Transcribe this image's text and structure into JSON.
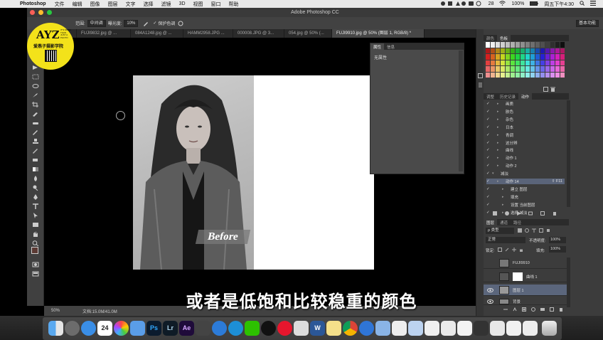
{
  "menubar": {
    "app_name": "Photoshop",
    "items": [
      "文件",
      "编辑",
      "图像",
      "图层",
      "文字",
      "选择",
      "滤镜",
      "3D",
      "视图",
      "窗口",
      "帮助"
    ],
    "battery": "100%",
    "clock": "周五下午4:30",
    "badge_count": "28"
  },
  "window": {
    "title": "Adobe Photoshop CC"
  },
  "options_bar": {
    "range_label": "范围:",
    "range_value": "中间调",
    "exposure_label": "曝光度:",
    "exposure_value": "10%",
    "protect_tones_label": "保护色调",
    "workspace": "基本功能"
  },
  "tabs": [
    {
      "label": ".jpg @ ...",
      "active": false
    },
    {
      "label": "FUJI9832.jpg @ ...",
      "active": false
    },
    {
      "label": "084A1248.jpg @ ...",
      "active": false
    },
    {
      "label": "HAMM2958.JPG ...",
      "active": false
    },
    {
      "label": "000008.JPG @ 3...",
      "active": false
    },
    {
      "label": "054.jpg @ 50% (...",
      "active": false
    },
    {
      "label": "FUJI9910.jpg @ 50% (图层 1, RGB/8) *",
      "active": true
    }
  ],
  "canvas": {
    "before_label": "Before"
  },
  "properties_panel": {
    "tabs": [
      "属性",
      "信息"
    ],
    "content": "无属性"
  },
  "status_bar": {
    "zoom": "50%",
    "doc_size": "文档:15.0M/41.0M"
  },
  "color_panel": {
    "tabs": [
      "颜色",
      "色板"
    ]
  },
  "actions_panel": {
    "tabs": [
      "调整",
      "历史记录",
      "动作"
    ],
    "items": [
      {
        "label": "画质",
        "level": 1,
        "selected": false
      },
      {
        "label": "肤色",
        "level": 1,
        "selected": false
      },
      {
        "label": "杂色",
        "level": 1,
        "selected": false
      },
      {
        "label": "日本",
        "level": 1,
        "selected": false
      },
      {
        "label": "青调",
        "level": 1,
        "selected": false
      },
      {
        "label": "这分辨",
        "level": 1,
        "selected": false
      },
      {
        "label": "曲线",
        "level": 1,
        "selected": false
      },
      {
        "label": "动作 1",
        "level": 1,
        "selected": false
      },
      {
        "label": "动作 2",
        "level": 1,
        "selected": false
      },
      {
        "label": "减淡",
        "level": 0,
        "selected": false
      },
      {
        "label": "动作 14",
        "level": 1,
        "selected": true,
        "shortcut": "⇧ F11"
      },
      {
        "label": "建立 图层",
        "level": 2,
        "selected": false
      },
      {
        "label": "填充",
        "level": 2,
        "selected": false
      },
      {
        "label": "设置 当前图层",
        "level": 2,
        "selected": false
      },
      {
        "label": "选择 减淡",
        "level": 2,
        "selected": false
      }
    ]
  },
  "layers_panel": {
    "tabs": [
      "图层",
      "通道",
      "路径"
    ],
    "kind_filter": "ρ 类型",
    "blend_mode": "正常",
    "opacity_label": "不透明度:",
    "opacity_value": "100%",
    "lock_label": "锁定:",
    "fill_label": "填充:",
    "fill_value": "100%",
    "layers": [
      {
        "name": "FUJI9910",
        "selected": false
      },
      {
        "name": "曲线 1",
        "selected": false
      },
      {
        "name": "图层 1",
        "selected": true
      },
      {
        "name": "背景",
        "selected": false
      }
    ]
  },
  "subtitle": "或者是低饱和比较稳重的颜色",
  "watermark": {
    "logo_text": "AYZ",
    "logo_small": "IT'S MORE\nTHAN\nJUST A\nPHOTO",
    "school": "爱燕子摄影学院"
  },
  "dock": {
    "calendar_day": "24",
    "apps": [
      "Finder",
      "Launchpad",
      "Safari",
      "Calendar",
      "Photos",
      "Mail",
      "Ps",
      "Lr",
      "Ae",
      "QuickTime",
      "iTunes",
      "WeChat",
      "QQ",
      "Weibo",
      "Word",
      "Notes",
      "Chrome",
      "Baidu",
      "QuickTime",
      "Preview",
      "Trash"
    ],
    "colors": {
      "ps": "#0b1b2e",
      "ps_text": "#31a8ff",
      "lr": "#0f1b26",
      "lr_text": "#add5ec",
      "ae": "#1f0b3a",
      "ae_text": "#d4a3ff"
    }
  }
}
